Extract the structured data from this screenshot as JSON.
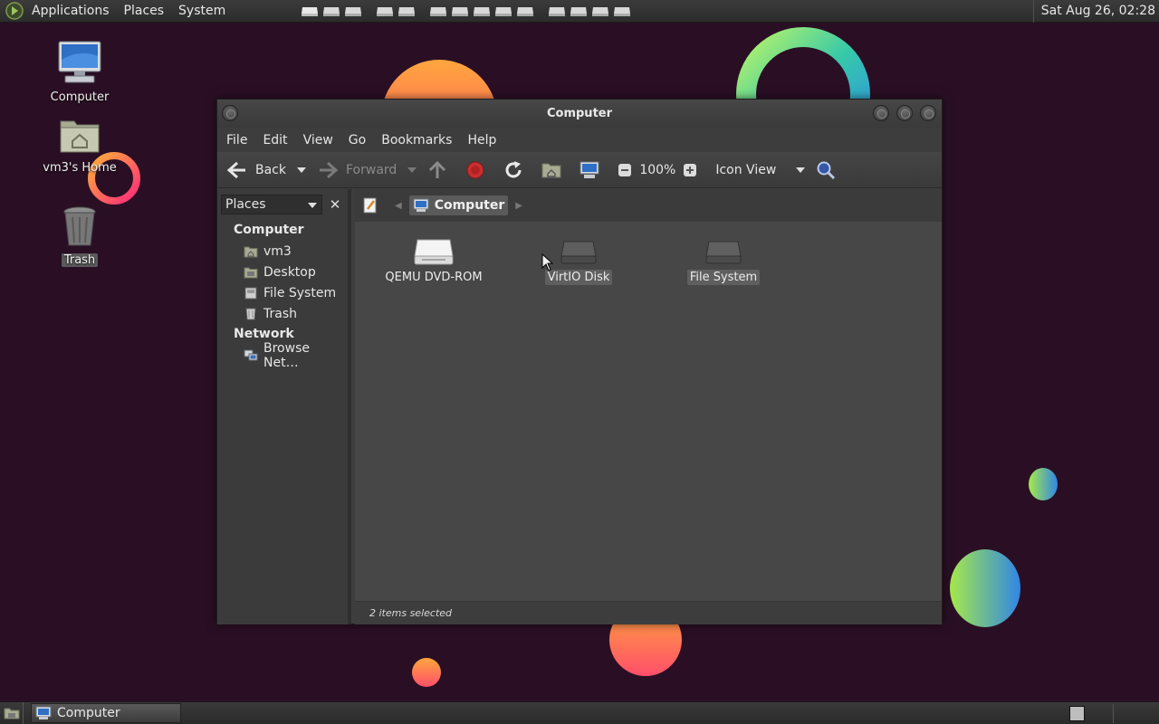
{
  "top_panel": {
    "menus": [
      "Applications",
      "Places",
      "System"
    ],
    "clock": "Sat Aug 26, 02:28"
  },
  "desktop": {
    "icons": [
      {
        "label": "Computer"
      },
      {
        "label": "vm3's Home"
      },
      {
        "label": "Trash"
      }
    ]
  },
  "window": {
    "title": "Computer",
    "menubar": [
      "File",
      "Edit",
      "View",
      "Go",
      "Bookmarks",
      "Help"
    ],
    "toolbar": {
      "back": "Back",
      "forward": "Forward",
      "zoom": "100%",
      "view_mode": "Icon View"
    },
    "sidebar": {
      "selector": "Places",
      "sections": [
        {
          "title": "Computer",
          "items": [
            "vm3",
            "Desktop",
            "File System",
            "Trash"
          ]
        },
        {
          "title": "Network",
          "items": [
            "Browse Net…"
          ]
        }
      ]
    },
    "location": {
      "current": "Computer"
    },
    "files": [
      {
        "name": "QEMU DVD-ROM",
        "selected": false
      },
      {
        "name": "VirtIO Disk",
        "selected": true
      },
      {
        "name": "File System",
        "selected": true
      }
    ],
    "status": "2 items selected"
  },
  "taskbar": {
    "task": "Computer"
  },
  "colors": {
    "wallpaper": "#2a0f24",
    "panel": "#2f2f2f",
    "window_bg": "#3d3d3d",
    "content_bg": "#474747"
  }
}
